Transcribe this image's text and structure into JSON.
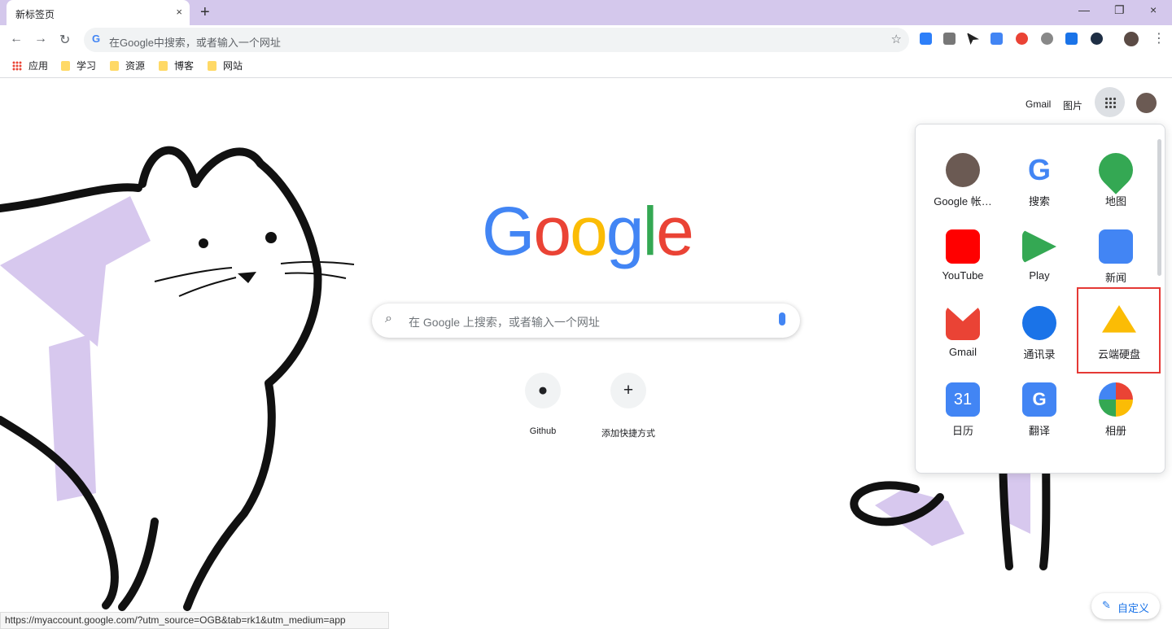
{
  "browser": {
    "tab_title": "新标签页",
    "omnibox_placeholder": "在Google中搜索，或者输入一个网址"
  },
  "bookmarks": [
    "应用",
    "学习",
    "资源",
    "博客",
    "网站"
  ],
  "header": {
    "gmail": "Gmail",
    "images": "图片"
  },
  "search": {
    "placeholder": "在 Google 上搜索，或者输入一个网址"
  },
  "shortcuts": [
    {
      "label": "Github",
      "icon": "github-icon"
    },
    {
      "label": "添加快捷方式",
      "icon": "plus-icon"
    }
  ],
  "apps_panel": {
    "apps": [
      {
        "label": "Google 帐…",
        "icon": "account-icon"
      },
      {
        "label": "搜索",
        "icon": "google-search-icon"
      },
      {
        "label": "地图",
        "icon": "maps-icon"
      },
      {
        "label": "YouTube",
        "icon": "youtube-icon"
      },
      {
        "label": "Play",
        "icon": "play-icon"
      },
      {
        "label": "新闻",
        "icon": "news-icon"
      },
      {
        "label": "Gmail",
        "icon": "gmail-icon"
      },
      {
        "label": "通讯录",
        "icon": "contacts-icon"
      },
      {
        "label": "云端硬盘",
        "icon": "drive-icon",
        "highlighted": true
      },
      {
        "label": "日历",
        "icon": "calendar-icon",
        "day": "31"
      },
      {
        "label": "翻译",
        "icon": "translate-icon"
      },
      {
        "label": "相册",
        "icon": "photos-icon"
      }
    ]
  },
  "status": "https://myaccount.google.com/?utm_source=OGB&tab=rk1&utm_medium=app",
  "customize": "自定义"
}
